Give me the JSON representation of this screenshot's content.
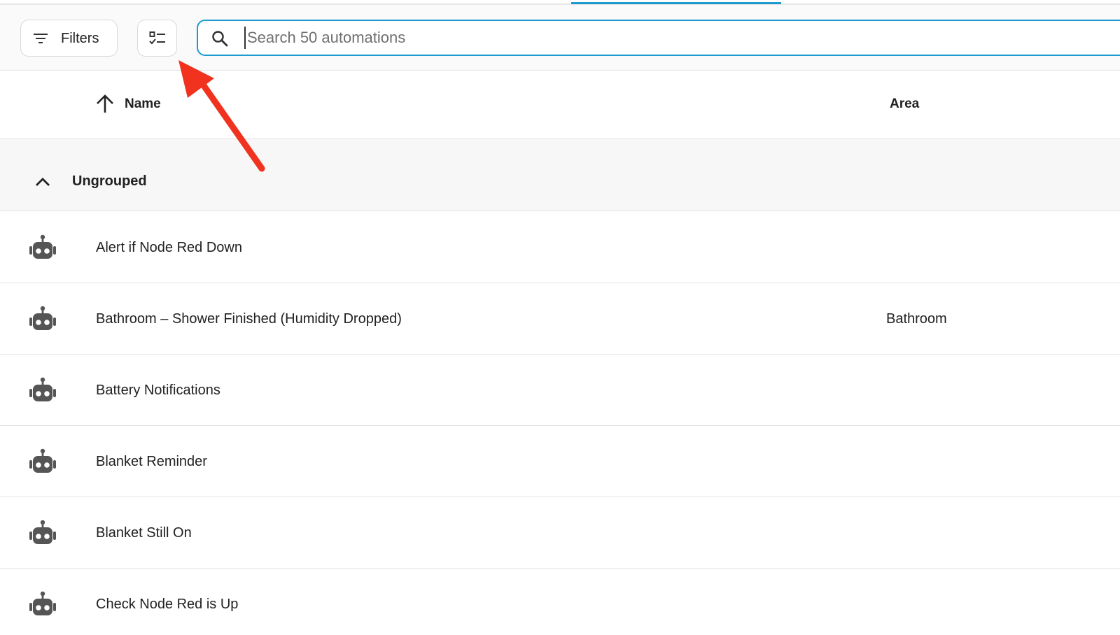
{
  "toolbar": {
    "filters_label": "Filters",
    "search_placeholder": "Search 50 automations"
  },
  "table": {
    "columns": {
      "name": "Name",
      "area": "Area"
    },
    "group": {
      "label": "Ungrouped"
    },
    "rows": [
      {
        "name": "Alert if Node Red Down",
        "area": ""
      },
      {
        "name": "Bathroom – Shower Finished (Humidity Dropped)",
        "area": "Bathroom"
      },
      {
        "name": "Battery Notifications",
        "area": ""
      },
      {
        "name": "Blanket Reminder",
        "area": ""
      },
      {
        "name": "Blanket Still On",
        "area": ""
      },
      {
        "name": "Check Node Red is Up",
        "area": ""
      }
    ]
  },
  "icons": {
    "filter": "filter-icon",
    "select": "multi-select-icon",
    "search": "search-icon",
    "sort": "arrow-up-icon",
    "collapse": "chevron-up-icon",
    "row": "robot-icon"
  },
  "colors": {
    "accent": "#1d9bd1",
    "annotation_arrow": "#f0321e",
    "icon": "#555555"
  }
}
